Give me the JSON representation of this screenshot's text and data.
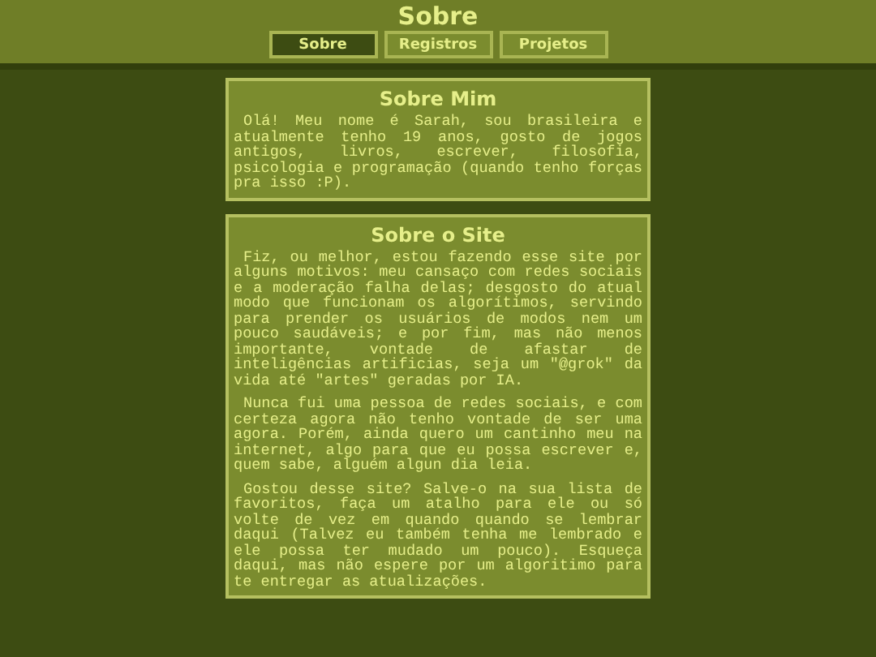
{
  "header": {
    "title": "Sobre"
  },
  "tabs": [
    {
      "label": "Sobre",
      "selected": true
    },
    {
      "label": "Registros",
      "selected": false
    },
    {
      "label": "Projetos",
      "selected": false
    }
  ],
  "sections": [
    {
      "title": "Sobre Mim",
      "paragraphs": [
        "Olá! Meu nome é Sarah, sou brasileira e atualmente tenho 19 anos, gosto de jogos antigos, livros, escrever, filosofia, psicologia e programação (quando tenho forças pra isso :P)."
      ]
    },
    {
      "title": "Sobre o Site",
      "paragraphs": [
        "Fiz, ou melhor, estou fazendo esse site por alguns motivos: meu cansaço com redes sociais e a moderação falha delas; desgosto do atual modo que funcionam os algorítimos, servindo para prender os usuários de modos nem um pouco saudáveis; e por fim, mas não menos importante, vontade de afastar de inteligências artificias, seja um \"@grok\" da vida até \"artes\" geradas por IA.",
        "Nunca fui uma pessoa de redes sociais, e com certeza agora não tenho vontade de ser uma agora. Porém, ainda quero um cantinho meu na internet, algo para que eu possa escrever e, quem sabe, alguém algun dia leia.",
        "Gostou desse site? Salve-o na sua lista de favoritos, faça um atalho para ele ou só volte de vez em quando quando se lembrar daqui (Talvez eu também tenha me lembrado e ele possa ter mudado um pouco). Esqueça daqui, mas não espere por um algoritimo para te entregar as atualizações."
      ]
    }
  ]
}
